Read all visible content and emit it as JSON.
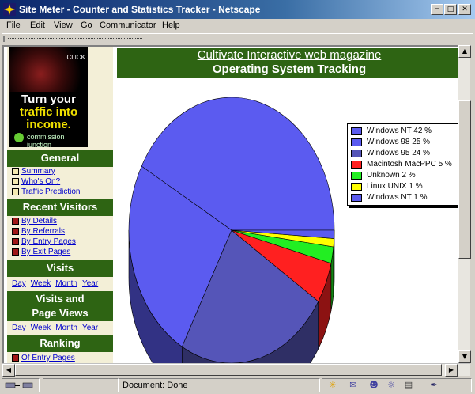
{
  "window": {
    "title": "Site Meter - Counter and Statistics Tracker - Netscape",
    "minimize_glyph": "0",
    "maximize_glyph": "1",
    "close_glyph": "r"
  },
  "menu": [
    "File",
    "Edit",
    "View",
    "Go",
    "Communicator",
    "Help"
  ],
  "ad": {
    "click_label": "CLICK",
    "headline_line1": "Turn your",
    "headline_line2": "traffic into",
    "headline_line3": "income.",
    "brand": "commission junction"
  },
  "sidebar": {
    "general": {
      "heading": "General",
      "links": [
        "Summary",
        "Who's On?",
        "Traffic Prediction"
      ]
    },
    "recent_visitors": {
      "heading": "Recent Visitors",
      "links": [
        "By Details",
        "By Referrals",
        "By Entry Pages",
        "By Exit Pages"
      ]
    },
    "visits": {
      "heading": "Visits",
      "periods": [
        "Day",
        "Week",
        "Month",
        "Year"
      ]
    },
    "visits_page_views": {
      "heading_line1": "Visits and",
      "heading_line2": "Page Views",
      "periods": [
        "Day",
        "Week",
        "Month",
        "Year"
      ]
    },
    "ranking": {
      "heading": "Ranking",
      "links": [
        "Of Entry Pages"
      ]
    }
  },
  "main": {
    "magazine_link": "Cultivate Interactive web magazine",
    "heading": "Operating System Tracking"
  },
  "status": {
    "text": "Document: Done"
  },
  "colors": {
    "sidebar_header": "#2e6413",
    "link": "#0000cc",
    "pie_blue": "#5b5bf0",
    "pie_navy": "#5555b8",
    "pie_red": "#ff2020",
    "pie_green": "#22ee22",
    "pie_yellow": "#ffff00"
  },
  "chart_data": {
    "type": "pie",
    "title": "",
    "legend_position": "right",
    "slices": [
      {
        "label": "Windows NT 42 %",
        "value": 42,
        "color": "#5b5bf0"
      },
      {
        "label": "Windows 98 25 %",
        "value": 25,
        "color": "#5b5bf0"
      },
      {
        "label": "Windows 95 24 %",
        "value": 24,
        "color": "#5555b8"
      },
      {
        "label": "Macintosh MacPPC 5 %",
        "value": 5,
        "color": "#ff2020"
      },
      {
        "label": "Unknown 2 %",
        "value": 2,
        "color": "#22ee22"
      },
      {
        "label": "Linux UNIX 1 %",
        "value": 1,
        "color": "#ffff00"
      },
      {
        "label": "Windows NT 1 %",
        "value": 1,
        "color": "#5b5bf0"
      }
    ]
  }
}
